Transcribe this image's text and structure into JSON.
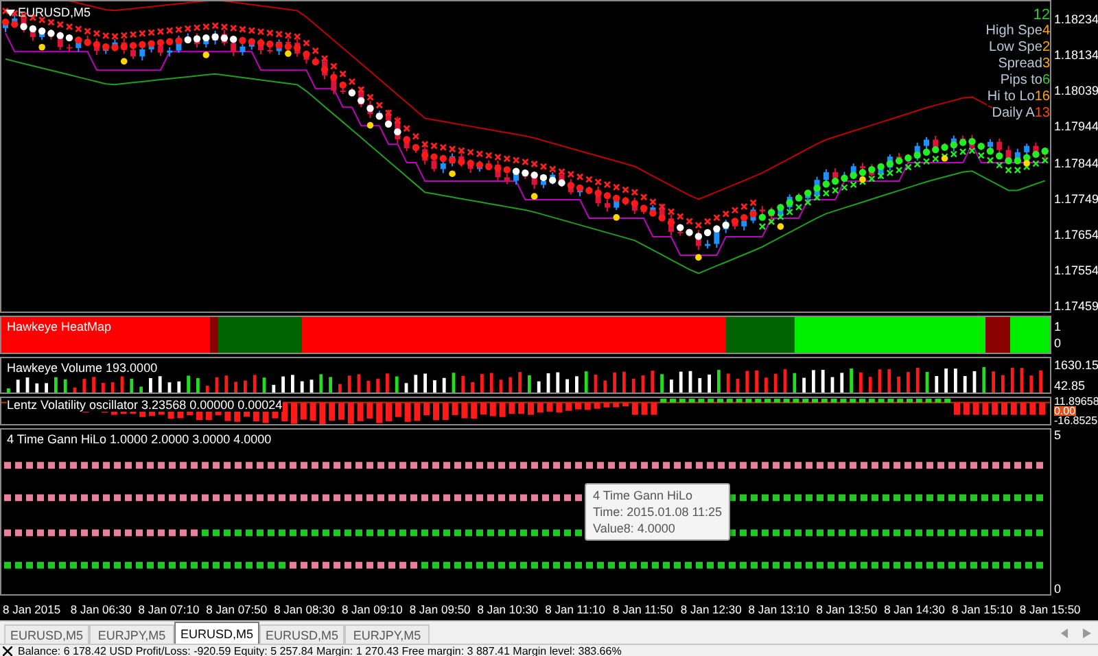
{
  "chart": {
    "symbol": "EURUSD,M5",
    "price_axis": [
      "1.18234",
      "1.18134",
      "1.18039",
      "1.17944",
      "1.17844",
      "1.17749",
      "1.17654",
      "1.17554",
      "1.17459"
    ],
    "info": {
      "top_value": "12",
      "rows": [
        {
          "label": "High Spe",
          "value": "4",
          "color": "#ffa500"
        },
        {
          "label": "Low Spe",
          "value": "2",
          "color": "#ffa500"
        },
        {
          "label": "Spread",
          "value": "3",
          "color": "#ffa500"
        },
        {
          "label": "Pips to",
          "value": "6",
          "color": "#32cd32"
        },
        {
          "label": "Hi to Lo",
          "value": "16",
          "color": "#ffa500"
        },
        {
          "label": "Daily A",
          "value": "13",
          "color": "#ff4500"
        }
      ]
    }
  },
  "heatmap": {
    "title": "Hawkeye HeatMap",
    "axis": [
      "1",
      "0"
    ]
  },
  "volume": {
    "title": "Hawkeye Volume 193.0000",
    "axis": [
      "1630.15",
      "42.85"
    ]
  },
  "lentz": {
    "title": "Lentz Volatility oscillator 3.23568 0.00000 0.00024",
    "axis": [
      "11.89658",
      "0.00",
      "-16.8525"
    ]
  },
  "gann": {
    "title": "4 Time Gann HiLo 1.0000 2.0000 3.0000 4.0000",
    "axis": [
      "5",
      "0"
    ],
    "tooltip": {
      "title": "4 Time Gann HiLo",
      "lines": [
        "Time: 2015.01.08 11:25",
        "Value8: 4.0000"
      ]
    }
  },
  "time_axis": [
    "8 Jan 2015",
    "8 Jan 06:30",
    "8 Jan 07:10",
    "8 Jan 07:50",
    "8 Jan 08:30",
    "8 Jan 09:10",
    "8 Jan 09:50",
    "8 Jan 10:30",
    "8 Jan 11:10",
    "8 Jan 11:50",
    "8 Jan 12:30",
    "8 Jan 13:10",
    "8 Jan 13:50",
    "8 Jan 14:30",
    "8 Jan 15:10",
    "8 Jan 15:50"
  ],
  "tabs": [
    {
      "label": "EURUSD,M5",
      "selected": false
    },
    {
      "label": "EURJPY,M5",
      "selected": false
    },
    {
      "label": "EURUSD,M5",
      "selected": true
    },
    {
      "label": "EURUSD,M5",
      "selected": false
    },
    {
      "label": "EURJPY,M5",
      "selected": false
    }
  ],
  "status_bar": "Balance: 6 178.42 USD  Profit/Loss: -920.59  Equity: 5 257.84  Margin: 1 270.43  Free margin: 3 887.41  Margin level: 383.66%"
}
